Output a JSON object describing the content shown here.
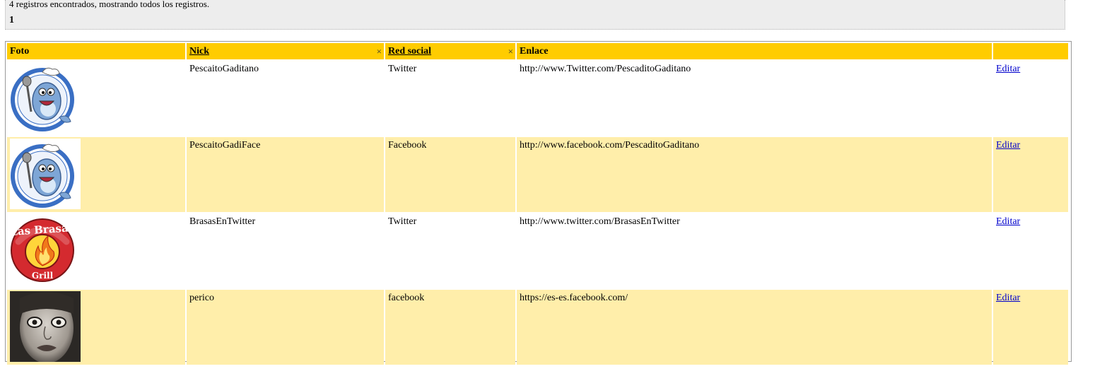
{
  "info": {
    "count_text": "4 registros encontrados, mostrando todos los registros.",
    "page": "1"
  },
  "table": {
    "headers": {
      "foto": "Foto",
      "nick": "Nick",
      "red_social": "Red social",
      "enlace": "Enlace",
      "actions": ""
    },
    "clear_glyph": "×",
    "rows": [
      {
        "photo": "fish-chef-logo",
        "nick": "PescaitoGaditano",
        "red_social": "Twitter",
        "enlace": "http://www.Twitter.com/PescaditoGaditano",
        "action": "Editar"
      },
      {
        "photo": "fish-chef-logo",
        "nick": "PescaitoGadiFace",
        "red_social": "Facebook",
        "enlace": "http://www.facebook.com/PescaditoGaditano",
        "action": "Editar"
      },
      {
        "photo": "las-brasas-grill-logo",
        "nick": "BrasasEnTwitter",
        "red_social": "Twitter",
        "enlace": "http://www.twitter.com/BrasasEnTwitter",
        "action": "Editar"
      },
      {
        "photo": "face-portrait-photo",
        "nick": "perico",
        "red_social": "facebook",
        "enlace": "https://es-es.facebook.com/",
        "action": "Editar"
      }
    ]
  },
  "colors": {
    "header_bg": "#ffcc00",
    "even_row_bg": "#ffeeaa",
    "odd_row_bg": "#ffffff",
    "panel_bg": "#ededed",
    "link": "#0000cc"
  }
}
